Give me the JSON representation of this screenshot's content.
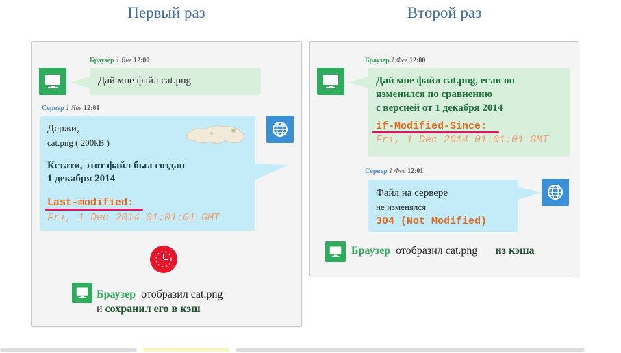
{
  "titles": {
    "left": "Первый раз",
    "right": "Второй раз"
  },
  "left": {
    "browser_meta": {
      "who": "Браузер",
      "date": "1 Янв",
      "time": "12:00"
    },
    "browser_msg": "Дай мне файл cat.png",
    "server_meta": {
      "who": "Сервер",
      "date": "1 Янв",
      "time": "12:01"
    },
    "server_msg": {
      "line1": "Держи,",
      "file_name": "cat.png (",
      "file_size": "200kB )",
      "note_line1": "Кстати, этот файл был создан",
      "note_line2": "1 декабря 2014",
      "header_name": "Last-modified:",
      "header_value": "Fri, 1 Dec 2014 01:01:01 GMT"
    },
    "footer": {
      "brand": "Браузер",
      "text1": "отобразил cat.png",
      "text2_prefix": "и",
      "text2": "сохранил его в кэш"
    }
  },
  "right": {
    "browser_meta": {
      "who": "Браузер",
      "date": "1 Фев",
      "time": "12:00"
    },
    "browser_msg": {
      "line1": "Дай мне файл cat.png, если он",
      "line2": "изменился по сравнению",
      "line3": "с версией от 1 декабря 2014",
      "header_name": "if-Modified-Since:",
      "header_value": "Fri, 1 Dec 2014 01:01:01 GMT"
    },
    "server_meta": {
      "who": "Сервер",
      "date": "1 Фев",
      "time": "12:01"
    },
    "server_msg": {
      "line1": "Файл на сервере",
      "line2": "не изменялся",
      "status": "304 (Not Modified)"
    },
    "footer": {
      "brand": "Браузер",
      "text1": "отобразил cat.png",
      "text2": "из кэша"
    }
  },
  "colors": {
    "green": "#2eab5c",
    "blue": "#3a8fd6",
    "accent_orange": "#e0691d",
    "underline": "#d81b60",
    "clock_red": "#e8162b"
  },
  "icons": [
    "monitor-icon",
    "globe-icon",
    "clock-icon",
    "cat-image"
  ]
}
